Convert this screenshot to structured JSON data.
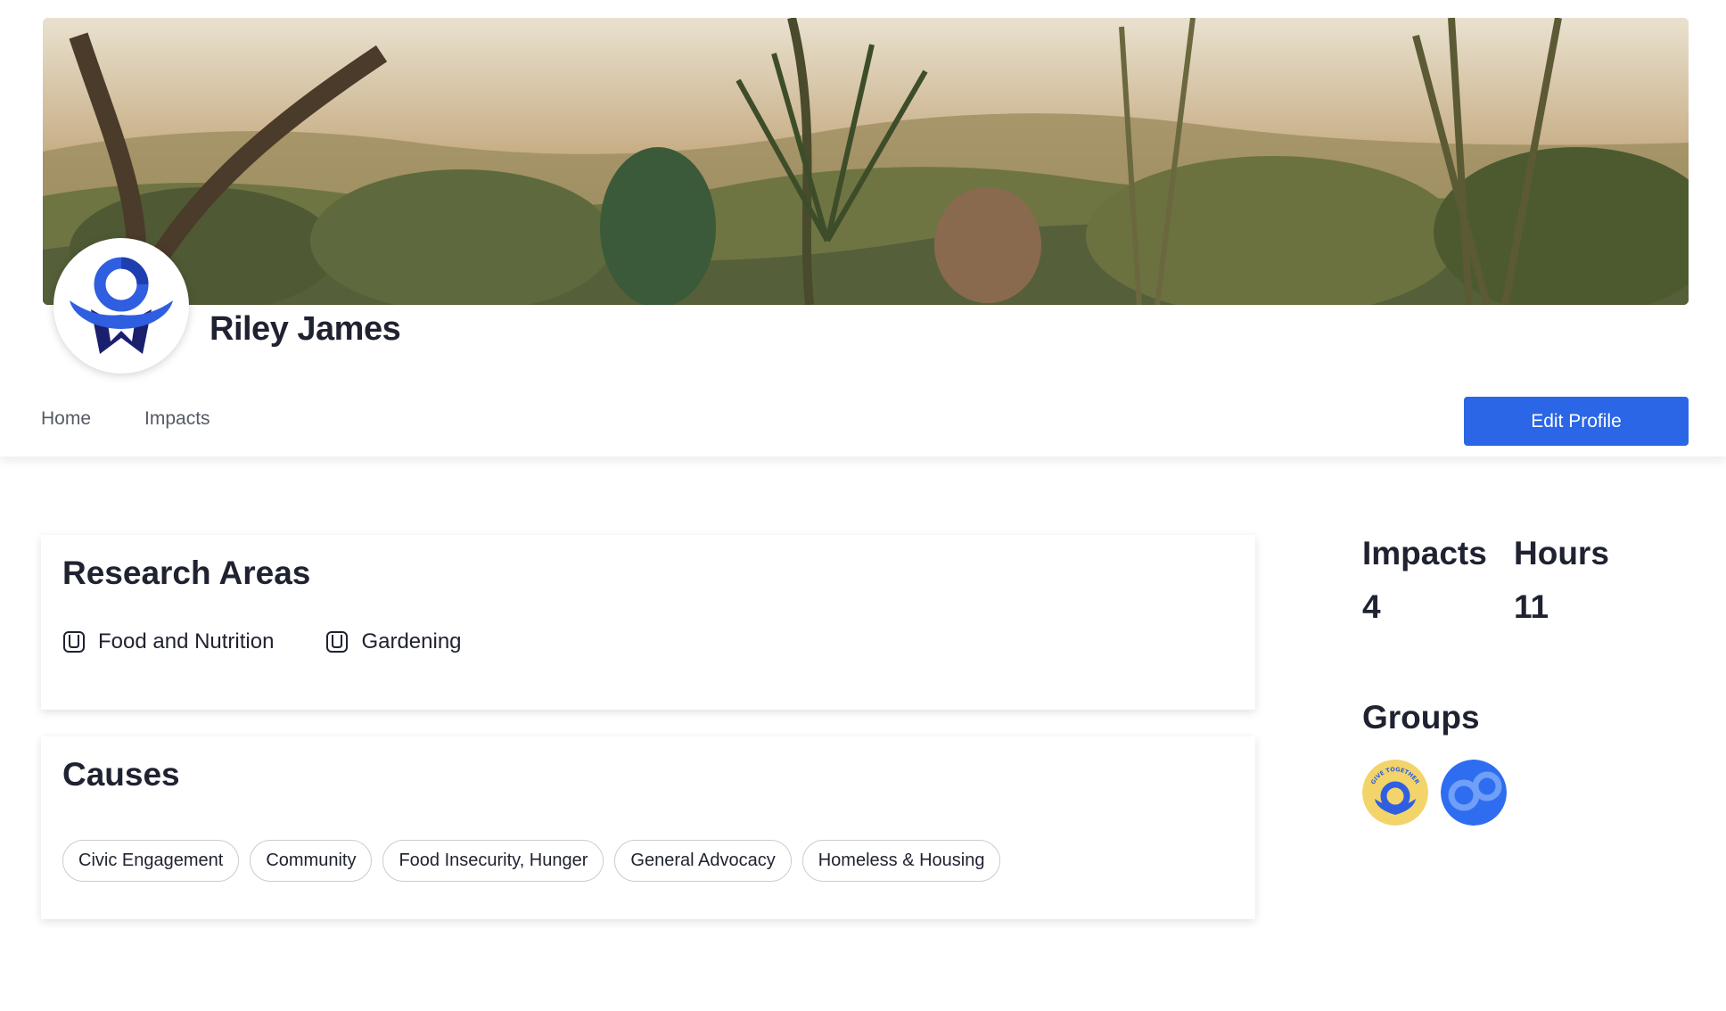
{
  "profile": {
    "name": "Riley James"
  },
  "nav": {
    "home": "Home",
    "impacts": "Impacts"
  },
  "actions": {
    "edit_profile": "Edit Profile"
  },
  "research_areas": {
    "title": "Research Areas",
    "items": [
      "Food and Nutrition",
      "Gardening"
    ]
  },
  "causes": {
    "title": "Causes",
    "items": [
      "Civic Engagement",
      "Community",
      "Food Insecurity, Hunger",
      "General Advocacy",
      "Homeless & Housing"
    ]
  },
  "stats": {
    "impacts_label": "Impacts",
    "impacts_value": "4",
    "hours_label": "Hours",
    "hours_value": "11"
  },
  "groups": {
    "title": "Groups",
    "logo_text": "GIVE TOGETHER GIVE"
  },
  "colors": {
    "accent": "#2a66e6",
    "logo_blue": "#2f5fe0",
    "logo_navy": "#1a1f6e",
    "logo_yellow": "#f2d46a"
  }
}
